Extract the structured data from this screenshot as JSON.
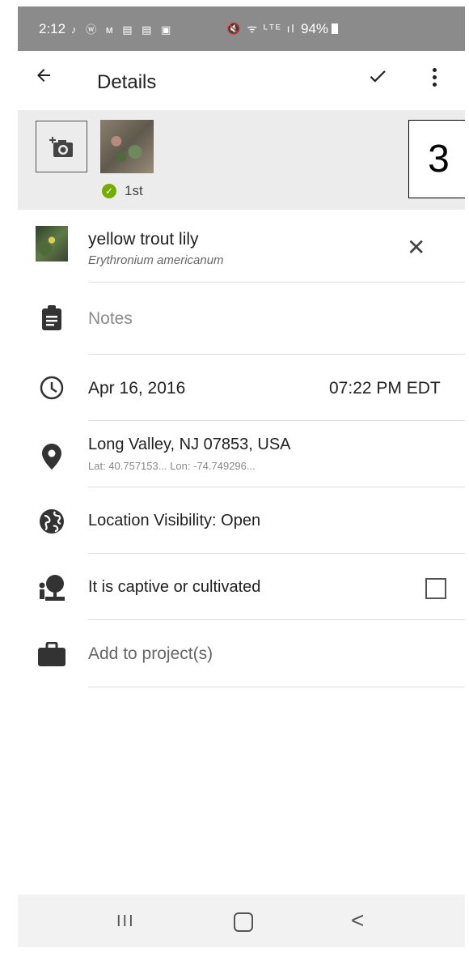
{
  "status_bar": {
    "time": "2:12",
    "left_icons": "♪ ⓦ ᴍ ▤ ▤ ▣",
    "right_icons": "🔇 ᯤ ᴸᵀᴱ ıl",
    "battery": "94%"
  },
  "app_bar": {
    "back_icon": "arrow-left",
    "title": "Details",
    "confirm_icon": "check",
    "menu_icon": "more-vertical"
  },
  "photos": {
    "add_photo_icon": "add-photo",
    "first_label": "1st",
    "badge_number": "3"
  },
  "taxon": {
    "common_name": "yellow trout lily",
    "scientific_name": "Erythronium americanum",
    "clear_icon": "close"
  },
  "notes": {
    "placeholder": "Notes",
    "icon": "clipboard"
  },
  "datetime": {
    "date": "Apr 16, 2016",
    "time": "07:22 PM EDT",
    "icon": "clock"
  },
  "location": {
    "place": "Long Valley, NJ 07853, USA",
    "coords": "Lat: 40.757153...   Lon: -74.749296...",
    "icon": "map-pin"
  },
  "visibility": {
    "label": "Location Visibility: Open",
    "icon": "globe"
  },
  "captive": {
    "label": "It is captive or cultivated",
    "checked": false,
    "icon": "captive-plant"
  },
  "projects": {
    "label": "Add to project(s)",
    "icon": "briefcase"
  },
  "nav_bar": {
    "recents": "III",
    "back": "<"
  },
  "colors": {
    "status_bar": "#8b8b8b",
    "photo_strip": "#ececec",
    "success_green": "#74ac00"
  }
}
